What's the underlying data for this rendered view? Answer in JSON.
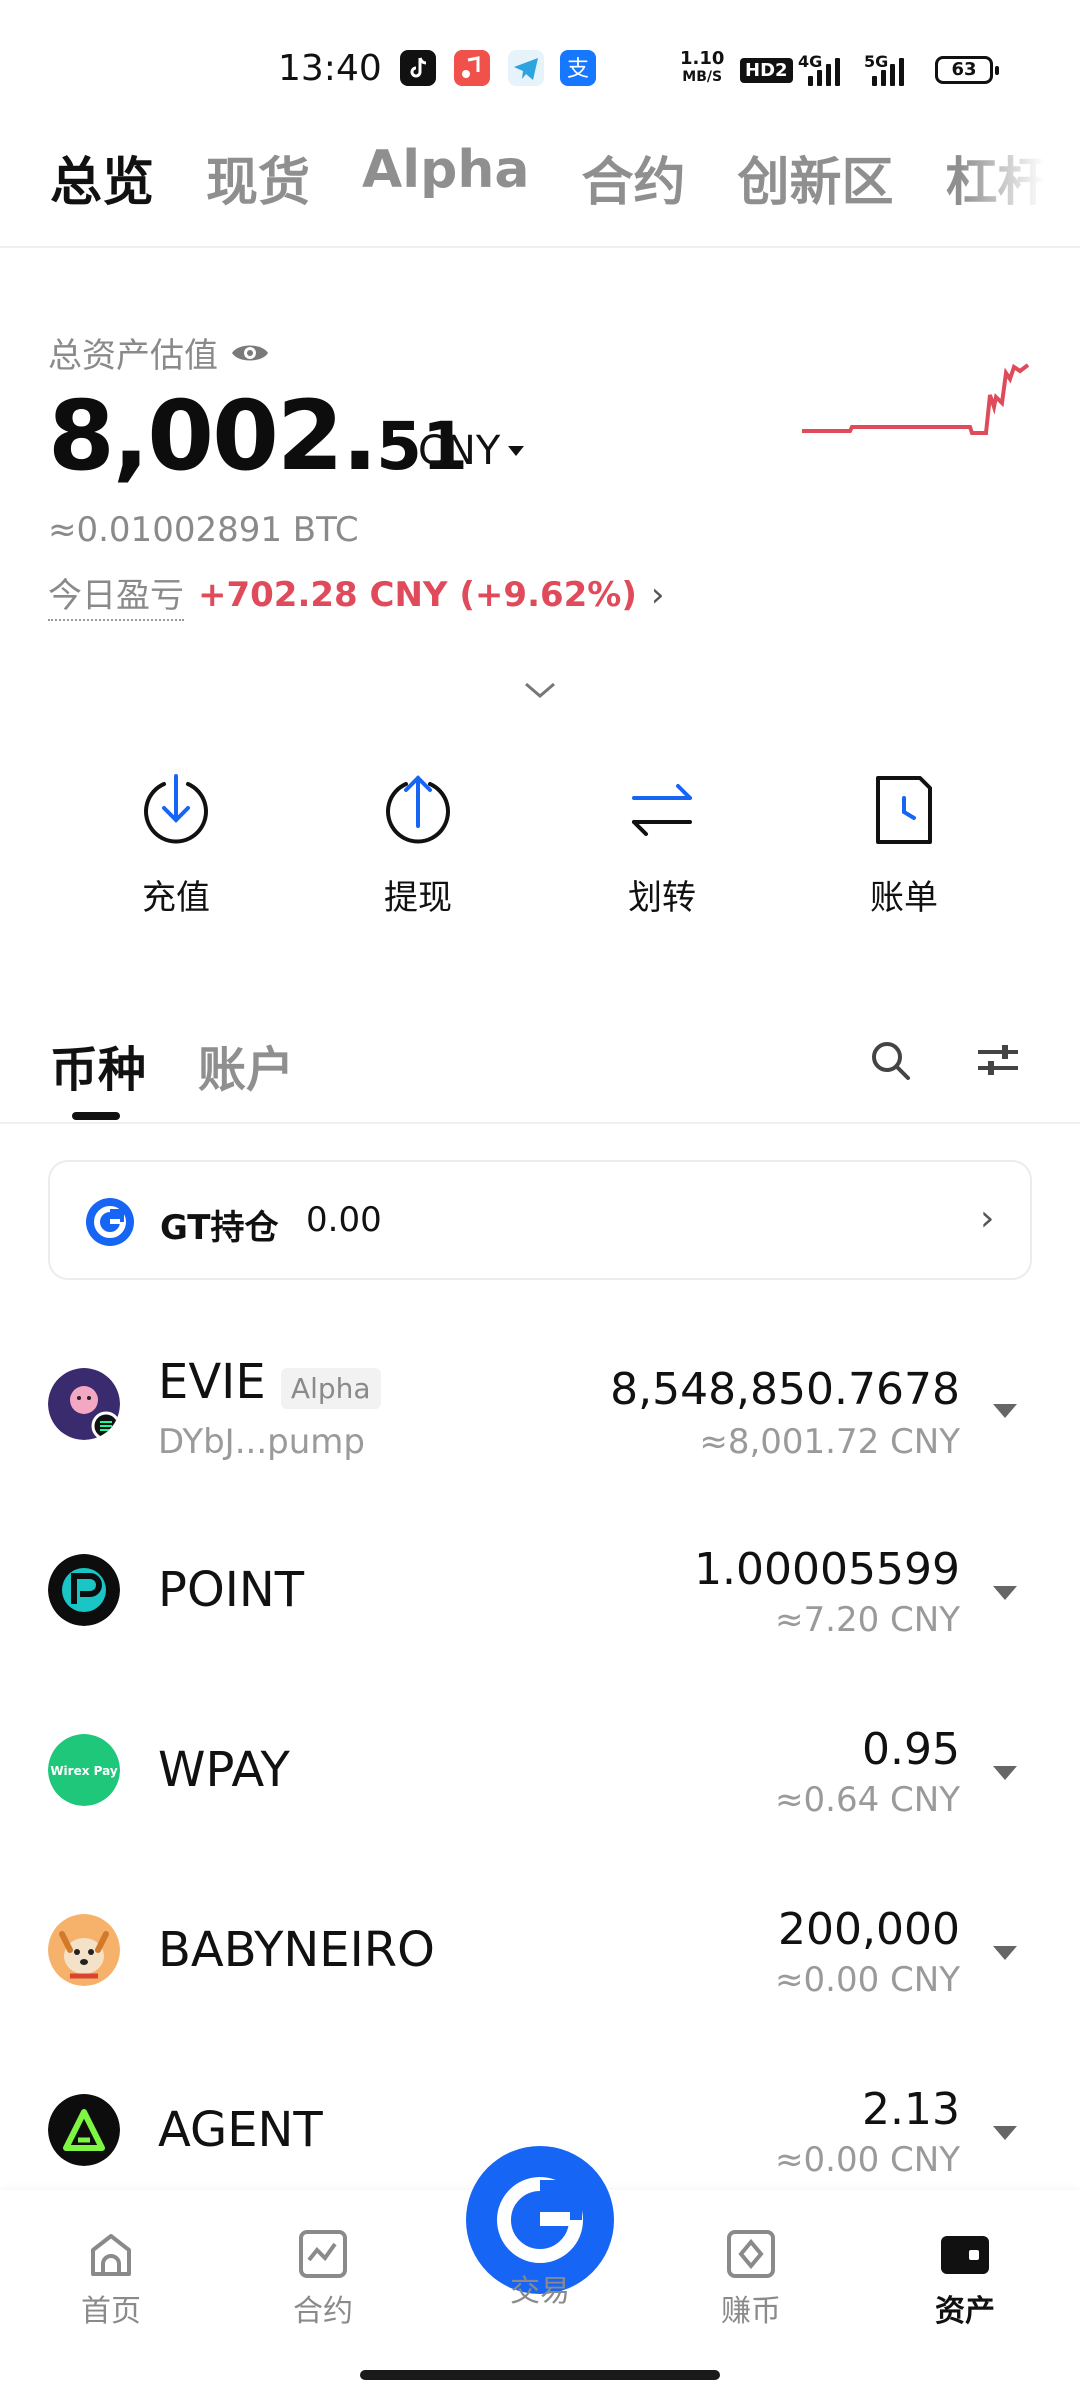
{
  "status_bar": {
    "time": "13:40",
    "net_speed_top": "1.10",
    "net_speed_bottom": "MB/S",
    "hd": "HD2",
    "signal1": "4G",
    "signal2": "5G",
    "battery": "63",
    "app_icons": [
      "tiktok-icon",
      "music-icon",
      "telegram-icon",
      "alipay-icon"
    ]
  },
  "top_tabs": [
    "总览",
    "现货",
    "Alpha",
    "合约",
    "创新区",
    "杠杆"
  ],
  "summary": {
    "label": "总资产估值",
    "total_main": "8,002.",
    "total_decimal": "51",
    "currency": "CNY",
    "btc_value": "≈0.01002891 BTC",
    "pnl_label": "今日盈亏",
    "pnl_value": "+702.28 CNY (+9.62%)",
    "pnl_color": "#e04b5b"
  },
  "actions": [
    {
      "label": "充值",
      "icon": "deposit-icon"
    },
    {
      "label": "提现",
      "icon": "withdraw-icon"
    },
    {
      "label": "划转",
      "icon": "transfer-icon"
    },
    {
      "label": "账单",
      "icon": "bill-icon"
    }
  ],
  "asset_tabs": [
    "币种",
    "账户"
  ],
  "gt_card": {
    "label": "GT持仓",
    "value": "0.00"
  },
  "coins": [
    {
      "name": "EVIE",
      "tag": "Alpha",
      "sub": "DYbJ...pump",
      "amount": "8,548,850.7678",
      "cny": "≈8,001.72 CNY"
    },
    {
      "name": "POINT",
      "tag": "",
      "sub": "",
      "amount": "1.00005599",
      "cny": "≈7.20 CNY"
    },
    {
      "name": "WPAY",
      "tag": "",
      "sub": "",
      "amount": "0.95",
      "cny": "≈0.64 CNY"
    },
    {
      "name": "BABYNEIRO",
      "tag": "",
      "sub": "",
      "amount": "200,000",
      "cny": "≈0.00 CNY"
    },
    {
      "name": "AGENT",
      "tag": "",
      "sub": "",
      "amount": "2.13",
      "cny": "≈0.00 CNY"
    }
  ],
  "wpay_logo_text": "Wirex Pay",
  "bottom_nav": [
    {
      "label": "首页",
      "icon": "home-icon"
    },
    {
      "label": "合约",
      "icon": "futures-icon"
    },
    {
      "label": "交易",
      "icon": "trade-icon"
    },
    {
      "label": "赚币",
      "icon": "earn-icon"
    },
    {
      "label": "资产",
      "icon": "wallet-icon"
    }
  ],
  "colors": {
    "accent": "#1665f5",
    "loss_red": "#e04b5b",
    "muted": "#8a8a8a"
  }
}
